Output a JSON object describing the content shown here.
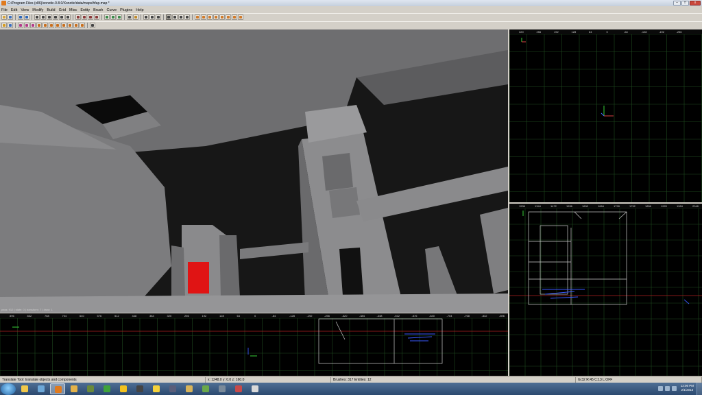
{
  "window": {
    "title": "C:/Program Files (x86)/xonotic-0.8.0/Xonotic/data/maps/hfap.map *",
    "controls": {
      "minimize": "–",
      "maximize": "□",
      "close": "x"
    }
  },
  "menu": [
    "File",
    "Edit",
    "View",
    "Modify",
    "Build",
    "Grid",
    "Misc",
    "Entity",
    "Brush",
    "Curve",
    "Plugins",
    "Help"
  ],
  "toolbar_row1": [
    {
      "name": "open-map-icon",
      "color": "#d8a53a"
    },
    {
      "name": "save-map-icon",
      "color": "#3a6fc0"
    },
    {
      "name": "undo-icon",
      "color": "#2c66b8"
    },
    {
      "name": "redo-icon",
      "color": "#2c66b8"
    },
    {
      "name": "flip-x-icon",
      "color": "#444444"
    },
    {
      "name": "flip-y-icon",
      "color": "#444444"
    },
    {
      "name": "flip-z-icon",
      "color": "#444444"
    },
    {
      "name": "rotate-x-icon",
      "color": "#444444"
    },
    {
      "name": "rotate-y-icon",
      "color": "#444444"
    },
    {
      "name": "rotate-z-icon",
      "color": "#444444"
    },
    {
      "name": "select-complete-tall-icon",
      "color": "#8a3a3a"
    },
    {
      "name": "select-touching-icon",
      "color": "#8a3a3a"
    },
    {
      "name": "select-partial-tall-icon",
      "color": "#8a3a3a"
    },
    {
      "name": "select-inside-icon",
      "color": "#8a3a3a"
    },
    {
      "name": "csg-subtract-icon",
      "color": "#3a8a4a"
    },
    {
      "name": "csg-merge-icon",
      "color": "#3a8a4a"
    },
    {
      "name": "make-hollow-icon",
      "color": "#3a8a4a"
    },
    {
      "name": "clipper-icon",
      "color": "#555555"
    },
    {
      "name": "texture-lock-icon",
      "color": "#c08a2a"
    },
    {
      "name": "change-view-icon",
      "color": "#444444"
    },
    {
      "name": "camera-view-icon",
      "color": "#444444"
    },
    {
      "name": "texture-view-icon",
      "color": "#444444"
    },
    {
      "name": "translate-tool-icon",
      "color": "#444444"
    },
    {
      "name": "rotate-tool-icon",
      "color": "#444444"
    },
    {
      "name": "scale-tool-icon",
      "color": "#444444"
    },
    {
      "name": "drag-tool-icon",
      "color": "#444444"
    },
    {
      "name": "patch-cylinder-icon",
      "color": "#d07a2a"
    },
    {
      "name": "patch-dense-icon",
      "color": "#d07a2a"
    },
    {
      "name": "patch-very-dense-icon",
      "color": "#d07a2a"
    },
    {
      "name": "patch-square-icon",
      "color": "#d07a2a"
    },
    {
      "name": "patch-bevel-icon",
      "color": "#d07a2a"
    },
    {
      "name": "patch-endcap-icon",
      "color": "#d07a2a"
    },
    {
      "name": "patch-invert-icon",
      "color": "#d07a2a"
    },
    {
      "name": "patch-cap-icon",
      "color": "#d07a2a"
    }
  ],
  "toolbar_row2": [
    {
      "name": "plugin-prefab-icon",
      "color": "#d69b1e"
    },
    {
      "name": "plugin-shader-icon",
      "color": "#3a6fc0"
    },
    {
      "name": "plugin-bobtoolz-icon",
      "color": "#b33a8a"
    },
    {
      "name": "plugin-merge-icon",
      "color": "#b33a8a"
    },
    {
      "name": "plugin-split-icon",
      "color": "#b33a8a"
    },
    {
      "name": "plugin-stair-icon",
      "color": "#c86f1e"
    },
    {
      "name": "plugin-door-icon",
      "color": "#c86f1e"
    },
    {
      "name": "plugin-path-icon",
      "color": "#c86f1e"
    },
    {
      "name": "plugin-camera-icon",
      "color": "#c86f1e"
    },
    {
      "name": "plugin-bobtoolz-b-icon",
      "color": "#c86f1e"
    },
    {
      "name": "plugin-ufo-icon",
      "color": "#c86f1e"
    },
    {
      "name": "plugin-vis-icon",
      "color": "#c86f1e"
    },
    {
      "name": "plugin-polygon-icon",
      "color": "#c86f1e"
    },
    {
      "name": "plugin-brushexport-icon",
      "color": "#444444"
    }
  ],
  "viewports": {
    "camera_info": "pass: 912 | state: 0 | transform: 7 | draw: 1"
  },
  "grid": {
    "top_labels": [
      "320",
      "256",
      "192",
      "128",
      "64",
      "0",
      "-64",
      "-128",
      "-192",
      "-256"
    ],
    "front_labels": [
      "896",
      "832",
      "768",
      "704",
      "640",
      "576",
      "512",
      "448",
      "384",
      "320",
      "256",
      "192",
      "128",
      "64",
      "0",
      "-64",
      "-128",
      "-192",
      "-256",
      "-320",
      "-384",
      "-448",
      "-512",
      "-576",
      "-640",
      "-704",
      "-768",
      "-832",
      "-896"
    ],
    "side_labels": [
      "1536",
      "1344",
      "1472",
      "1536",
      "1600",
      "1664",
      "1728",
      "1792",
      "1856",
      "1920",
      "1984",
      "2048"
    ]
  },
  "status": {
    "tool_hint": "Translate Tool: translate objects and components",
    "coords": "x:  1248.0  y:    0.0  z:   160.0",
    "counts": "Brushes: 317 Entities: 12",
    "grid_info": "G:32  R:45  C:13  L:OFF"
  },
  "taskbar": {
    "apps": [
      {
        "name": "explorer-taskbar-icon",
        "color": "#f1c84a"
      },
      {
        "name": "paint-taskbar-icon",
        "color": "#6da8d8"
      },
      {
        "name": "netradiant-taskbar-icon",
        "color": "#e07a1e",
        "active": true
      },
      {
        "name": "pencil-taskbar-icon",
        "color": "#e3b24a"
      },
      {
        "name": "minecraft-taskbar-icon",
        "color": "#6a8a3a"
      },
      {
        "name": "utorrent-taskbar-icon",
        "color": "#3fa33a"
      },
      {
        "name": "norton-taskbar-icon",
        "color": "#f3c21e"
      },
      {
        "name": "steam-taskbar-icon",
        "color": "#444444"
      },
      {
        "name": "burst-taskbar-icon",
        "color": "#f5d23a"
      },
      {
        "name": "illustrator-taskbar-icon",
        "color": "#5a5e7a"
      },
      {
        "name": "photo-taskbar-icon",
        "color": "#d8b45a"
      },
      {
        "name": "xonotic-taskbar-icon",
        "color": "#6aa84a"
      },
      {
        "name": "blender-taskbar-icon",
        "color": "#7a8a9a"
      },
      {
        "name": "wacom-taskbar-icon",
        "color": "#c84a4a"
      },
      {
        "name": "paint-net-taskbar-icon",
        "color": "#d9d9d9"
      }
    ],
    "time": "12:06 PM",
    "date": "2/1/2013"
  }
}
